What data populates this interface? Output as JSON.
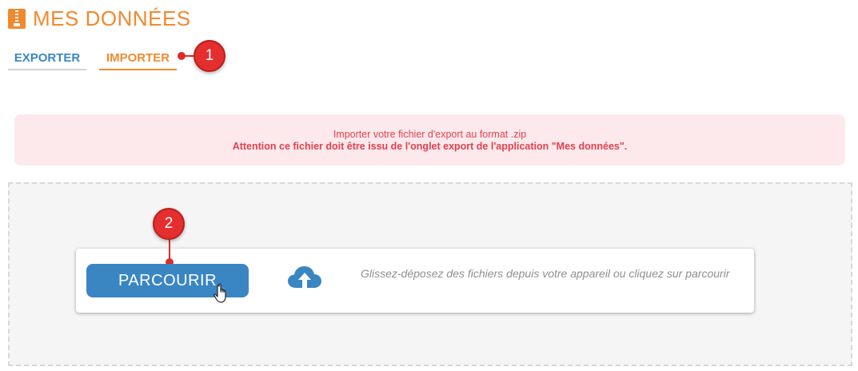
{
  "header": {
    "title": "MES DONNÉES",
    "icon": "zip-archive-icon",
    "accent": "#f08a30"
  },
  "tabs": [
    {
      "label": "EXPORTER",
      "active": false
    },
    {
      "label": "IMPORTER",
      "active": true
    }
  ],
  "callouts": [
    {
      "number": "1"
    },
    {
      "number": "2"
    }
  ],
  "alert": {
    "line1": "Importer votre fichier d'export au format .zip",
    "line2": "Attention ce fichier doit être issu de l'onglet export de l'application \"Mes données\".",
    "line2_end": "."
  },
  "upload": {
    "button_label": "PARCOURIR",
    "hint": "Glissez-déposez des fichiers depuis votre appareil ou cliquez sur parcourir",
    "icon": "cloud-upload-icon"
  },
  "colors": {
    "primary": "#3a86c2",
    "accent": "#f08a30",
    "callout": "#e52e2e",
    "alert_bg": "#fde9ec",
    "alert_text": "#e0414f"
  }
}
